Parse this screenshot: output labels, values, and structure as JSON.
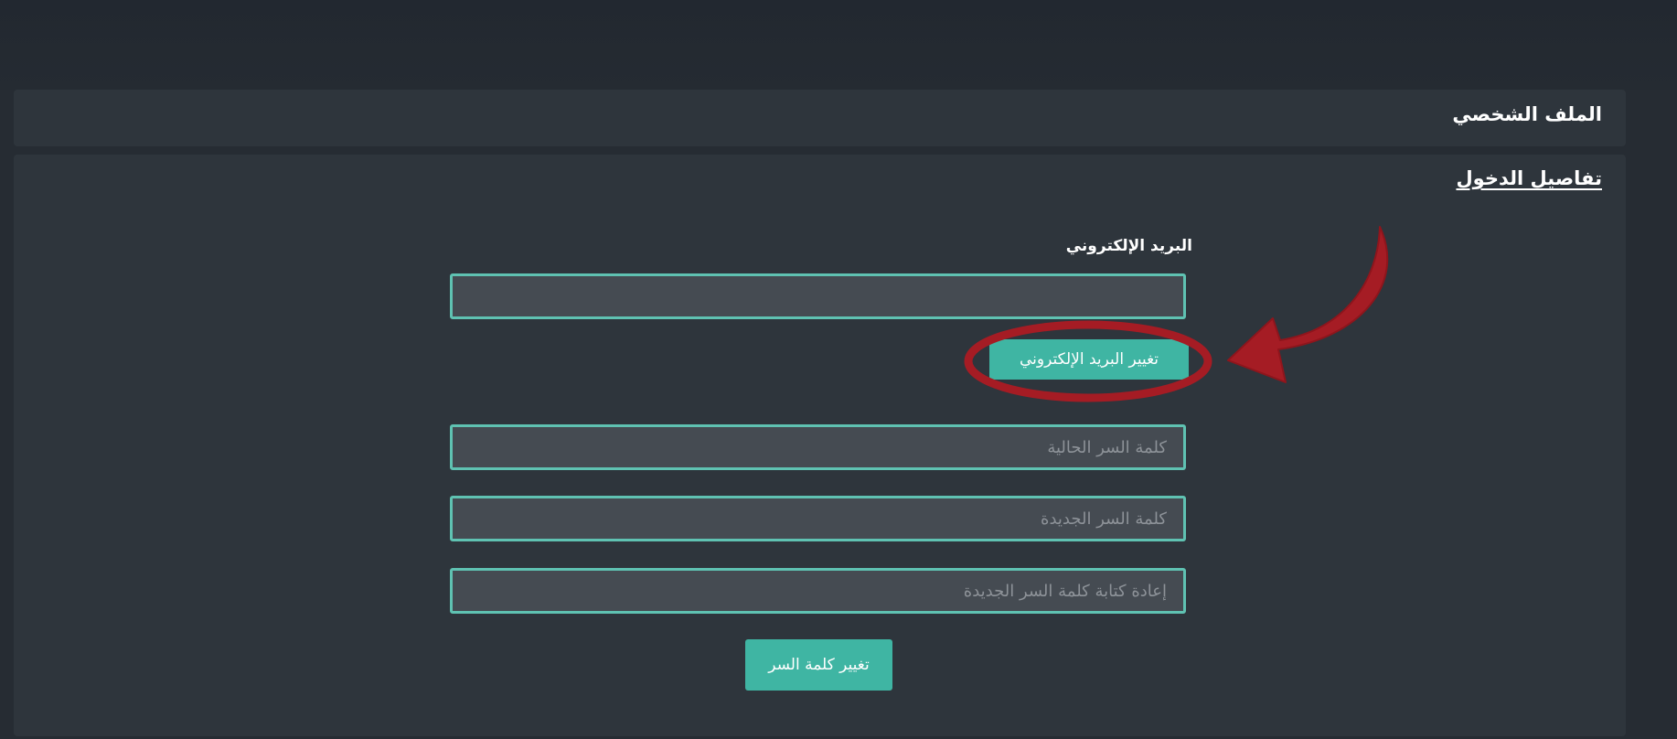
{
  "profile": {
    "title": "الملف الشخصي"
  },
  "login_details": {
    "title": "تفاصيل الدخول",
    "email_label": "البريد الإلكتروني",
    "email_value": "",
    "change_email_button": "تغيير البريد الإلكتروني",
    "current_password_placeholder": "كلمة السر الحالية",
    "new_password_placeholder": "كلمة السر الجديدة",
    "confirm_password_placeholder": "إعادة كتابة كلمة السر الجديدة",
    "change_password_button": "تغيير كلمة السر"
  },
  "annotation": {
    "color": "#a51c24",
    "shapes": [
      "highlight-ellipse",
      "pointer-arrow"
    ]
  },
  "colors": {
    "accent": "#3fb5a3",
    "field_border": "#5fc2b2",
    "panel": "#2e353c",
    "background": "#262c33"
  }
}
